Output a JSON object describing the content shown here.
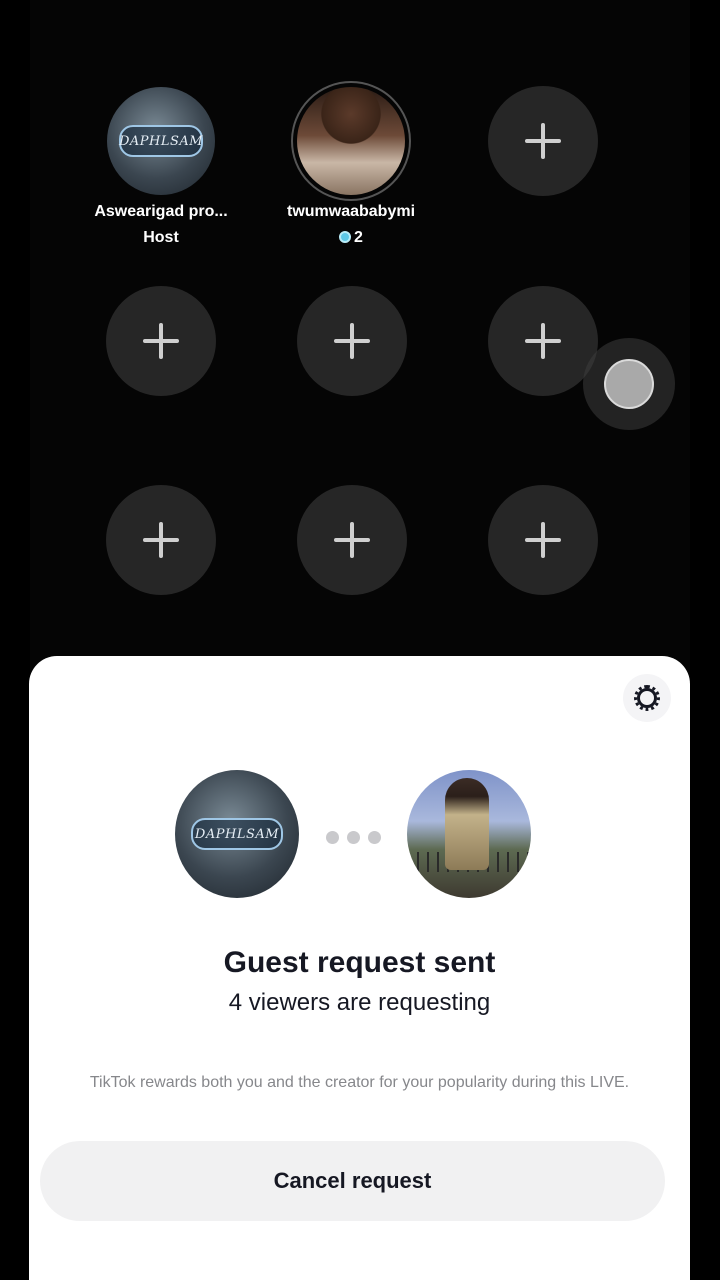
{
  "grid": {
    "host": {
      "name": "Aswearigad pro...",
      "role": "Host",
      "logo_text": "DAPHLSAM"
    },
    "guest": {
      "name": "twumwaababymi",
      "gems": "2"
    }
  },
  "sheet": {
    "host_logo_text": "DAPHLSAM",
    "title": "Guest request sent",
    "subtitle": "4 viewers are requesting",
    "note": "TikTok rewards both you and the creator for your popularity during this LIVE.",
    "cancel_label": "Cancel request"
  }
}
